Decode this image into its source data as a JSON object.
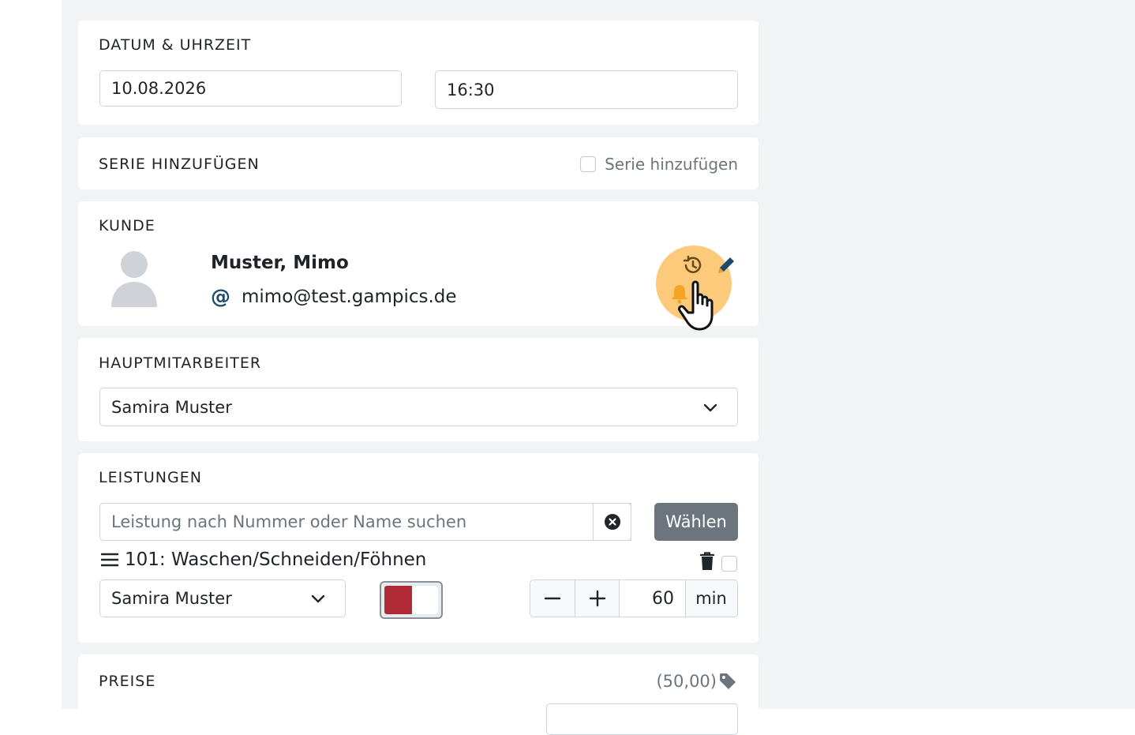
{
  "datetime": {
    "title": "DATUM & UHRZEIT",
    "date_value": "10.08.2026",
    "time_value": "16:30"
  },
  "series": {
    "title": "SERIE HINZUFÜGEN",
    "checkbox_label": "Serie hinzufügen",
    "checked": false
  },
  "customer": {
    "title": "KUNDE",
    "name": "Muster, Mimo",
    "email_symbol": "@",
    "email": "mimo@test.gampics.de",
    "icons": [
      "user-avatar-icon",
      "history-icon",
      "pencil-icon",
      "bell-icon"
    ],
    "highlight_color": "#fdc97a"
  },
  "main_employee": {
    "title": "HAUPTMITARBEITER",
    "selected": "Samira Muster"
  },
  "services": {
    "title": "LEISTUNGEN",
    "search_placeholder": "Leistung nach Nummer oder Name suchen",
    "choose_button": "Wählen",
    "items": [
      {
        "label": "101: Waschen/Schneiden/Föhnen",
        "employee": "Samira Muster",
        "color": "#b02a37",
        "duration": "60",
        "unit": "min"
      }
    ]
  },
  "prices": {
    "title": "PREISE",
    "total": "(50,00)"
  },
  "colors": {
    "panel_bg": "#f2f3f5",
    "accent_dark": "#1b4a6b",
    "bell": "#f5a524"
  }
}
